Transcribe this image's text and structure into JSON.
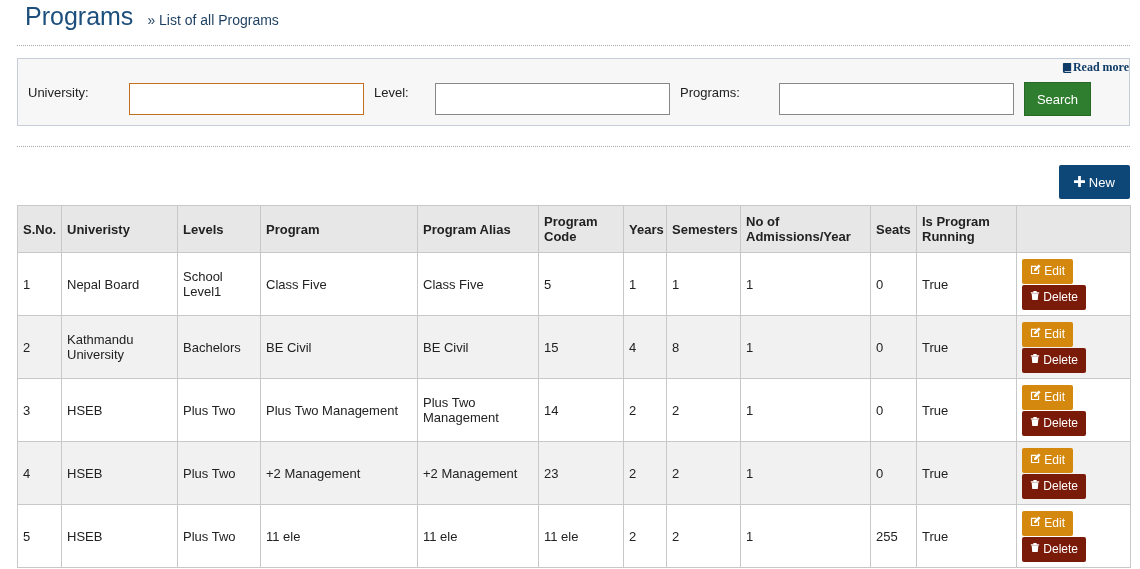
{
  "page": {
    "title": "Programs",
    "breadcrumb_mark": "»",
    "subtitle": "List of all Programs"
  },
  "filter_panel": {
    "read_more": "Read more",
    "fields": [
      {
        "label": "University:",
        "focused": true
      },
      {
        "label": "Level:",
        "focused": false
      },
      {
        "label": "Programs:",
        "focused": false
      }
    ],
    "search_button": "Search"
  },
  "new_button": "New",
  "table": {
    "columns": [
      "S.No.",
      "Univeristy",
      "Levels",
      "Program",
      "Program Alias",
      "Program Code",
      "Years",
      "Semesters",
      "No of Admissions/Year",
      "Seats",
      "Is Program Running",
      ""
    ],
    "rows": [
      {
        "cells": [
          "1",
          "Nepal Board",
          "School Level1",
          "Class Five",
          "Class Five",
          "5",
          "1",
          "1",
          "1",
          "0",
          "True"
        ],
        "actions": [
          "Edit",
          "Delete"
        ]
      },
      {
        "cells": [
          "2",
          "Kathmandu University",
          "Bachelors",
          "BE Civil",
          "BE Civil",
          "15",
          "4",
          "8",
          "1",
          "0",
          "True"
        ],
        "actions": [
          "Edit",
          "Delete"
        ]
      },
      {
        "cells": [
          "3",
          "HSEB",
          "Plus Two",
          "Plus Two Management",
          "Plus Two Management",
          "14",
          "2",
          "2",
          "1",
          "0",
          "True"
        ],
        "actions": [
          "Edit",
          "Delete"
        ]
      },
      {
        "cells": [
          "4",
          "HSEB",
          "Plus Two",
          "+2 Management",
          "+2 Management",
          "23",
          "2",
          "2",
          "1",
          "0",
          "True"
        ],
        "actions": [
          "Edit",
          "Delete"
        ]
      },
      {
        "cells": [
          "5",
          "HSEB",
          "Plus Two",
          "11 ele",
          "11 ele",
          "11 ele",
          "2",
          "2",
          "1",
          "255",
          "True"
        ],
        "actions": [
          "Edit",
          "Delete"
        ]
      }
    ]
  }
}
